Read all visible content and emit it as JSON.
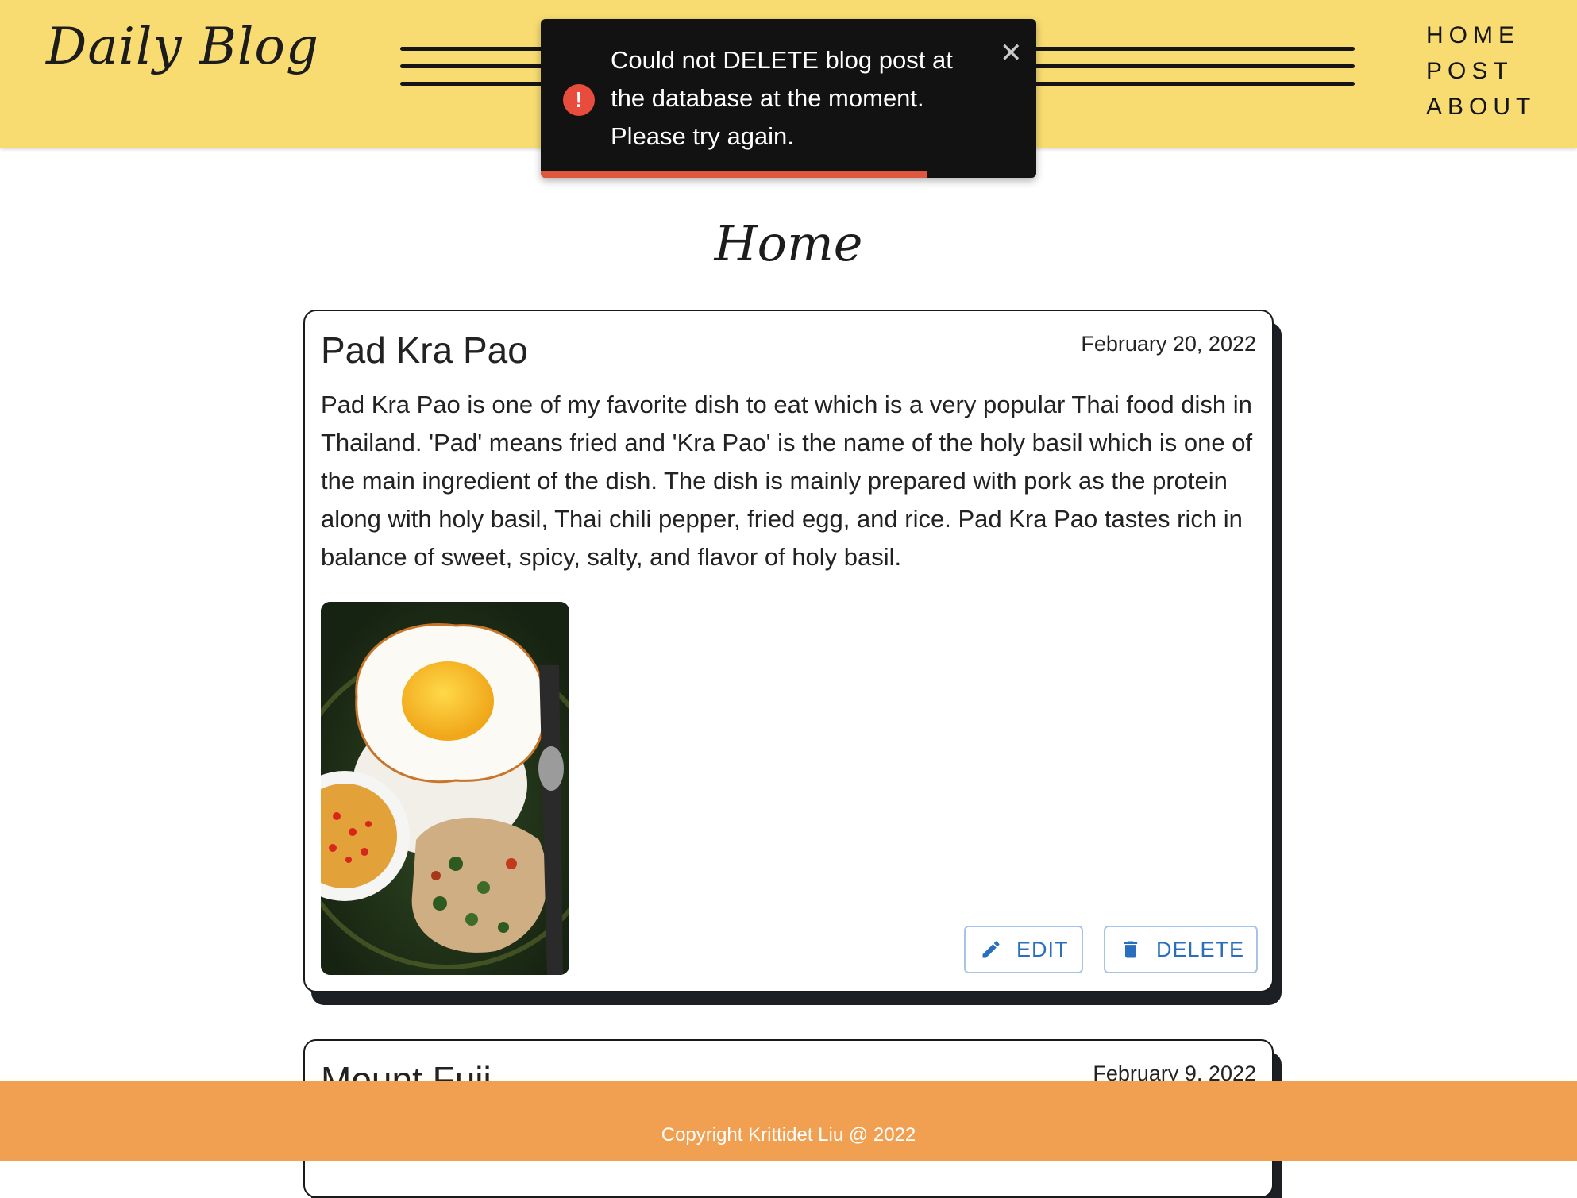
{
  "header": {
    "logo": "Daily Blog",
    "nav": [
      "HOME",
      "POST",
      "ABOUT"
    ]
  },
  "toast": {
    "message": "Could not DELETE blog post at the database at the moment. Please try again.",
    "icon": "alert-circle-icon",
    "close_glyph": "✕",
    "accent_color": "#e0573f",
    "progress_remaining": 0.78
  },
  "page": {
    "title": "Home"
  },
  "posts": [
    {
      "title": "Pad Kra Pao",
      "date": "February 20, 2022",
      "body": "Pad Kra Pao is one of my favorite dish to eat which is a very popular Thai food dish in Thailand. 'Pad' means fried and 'Kra Pao' is the name of the holy basil which is one of the main ingredient of the dish. The dish is mainly prepared with pork as the protein along with holy basil, Thai chili pepper, fried egg, and rice. Pad Kra Pao tastes rich in balance of sweet, spicy, salty, and flavor of holy basil.",
      "edit_label": "EDIT",
      "delete_label": "DELETE"
    },
    {
      "title": "Mount Fuji",
      "date": "February 9, 2022"
    }
  ],
  "footer": {
    "text": "Copyright Krittidet Liu @ 2022"
  },
  "colors": {
    "header_bg": "#f8dc72",
    "footer_bg": "#f1a052",
    "button_text": "#2a6fbd"
  }
}
